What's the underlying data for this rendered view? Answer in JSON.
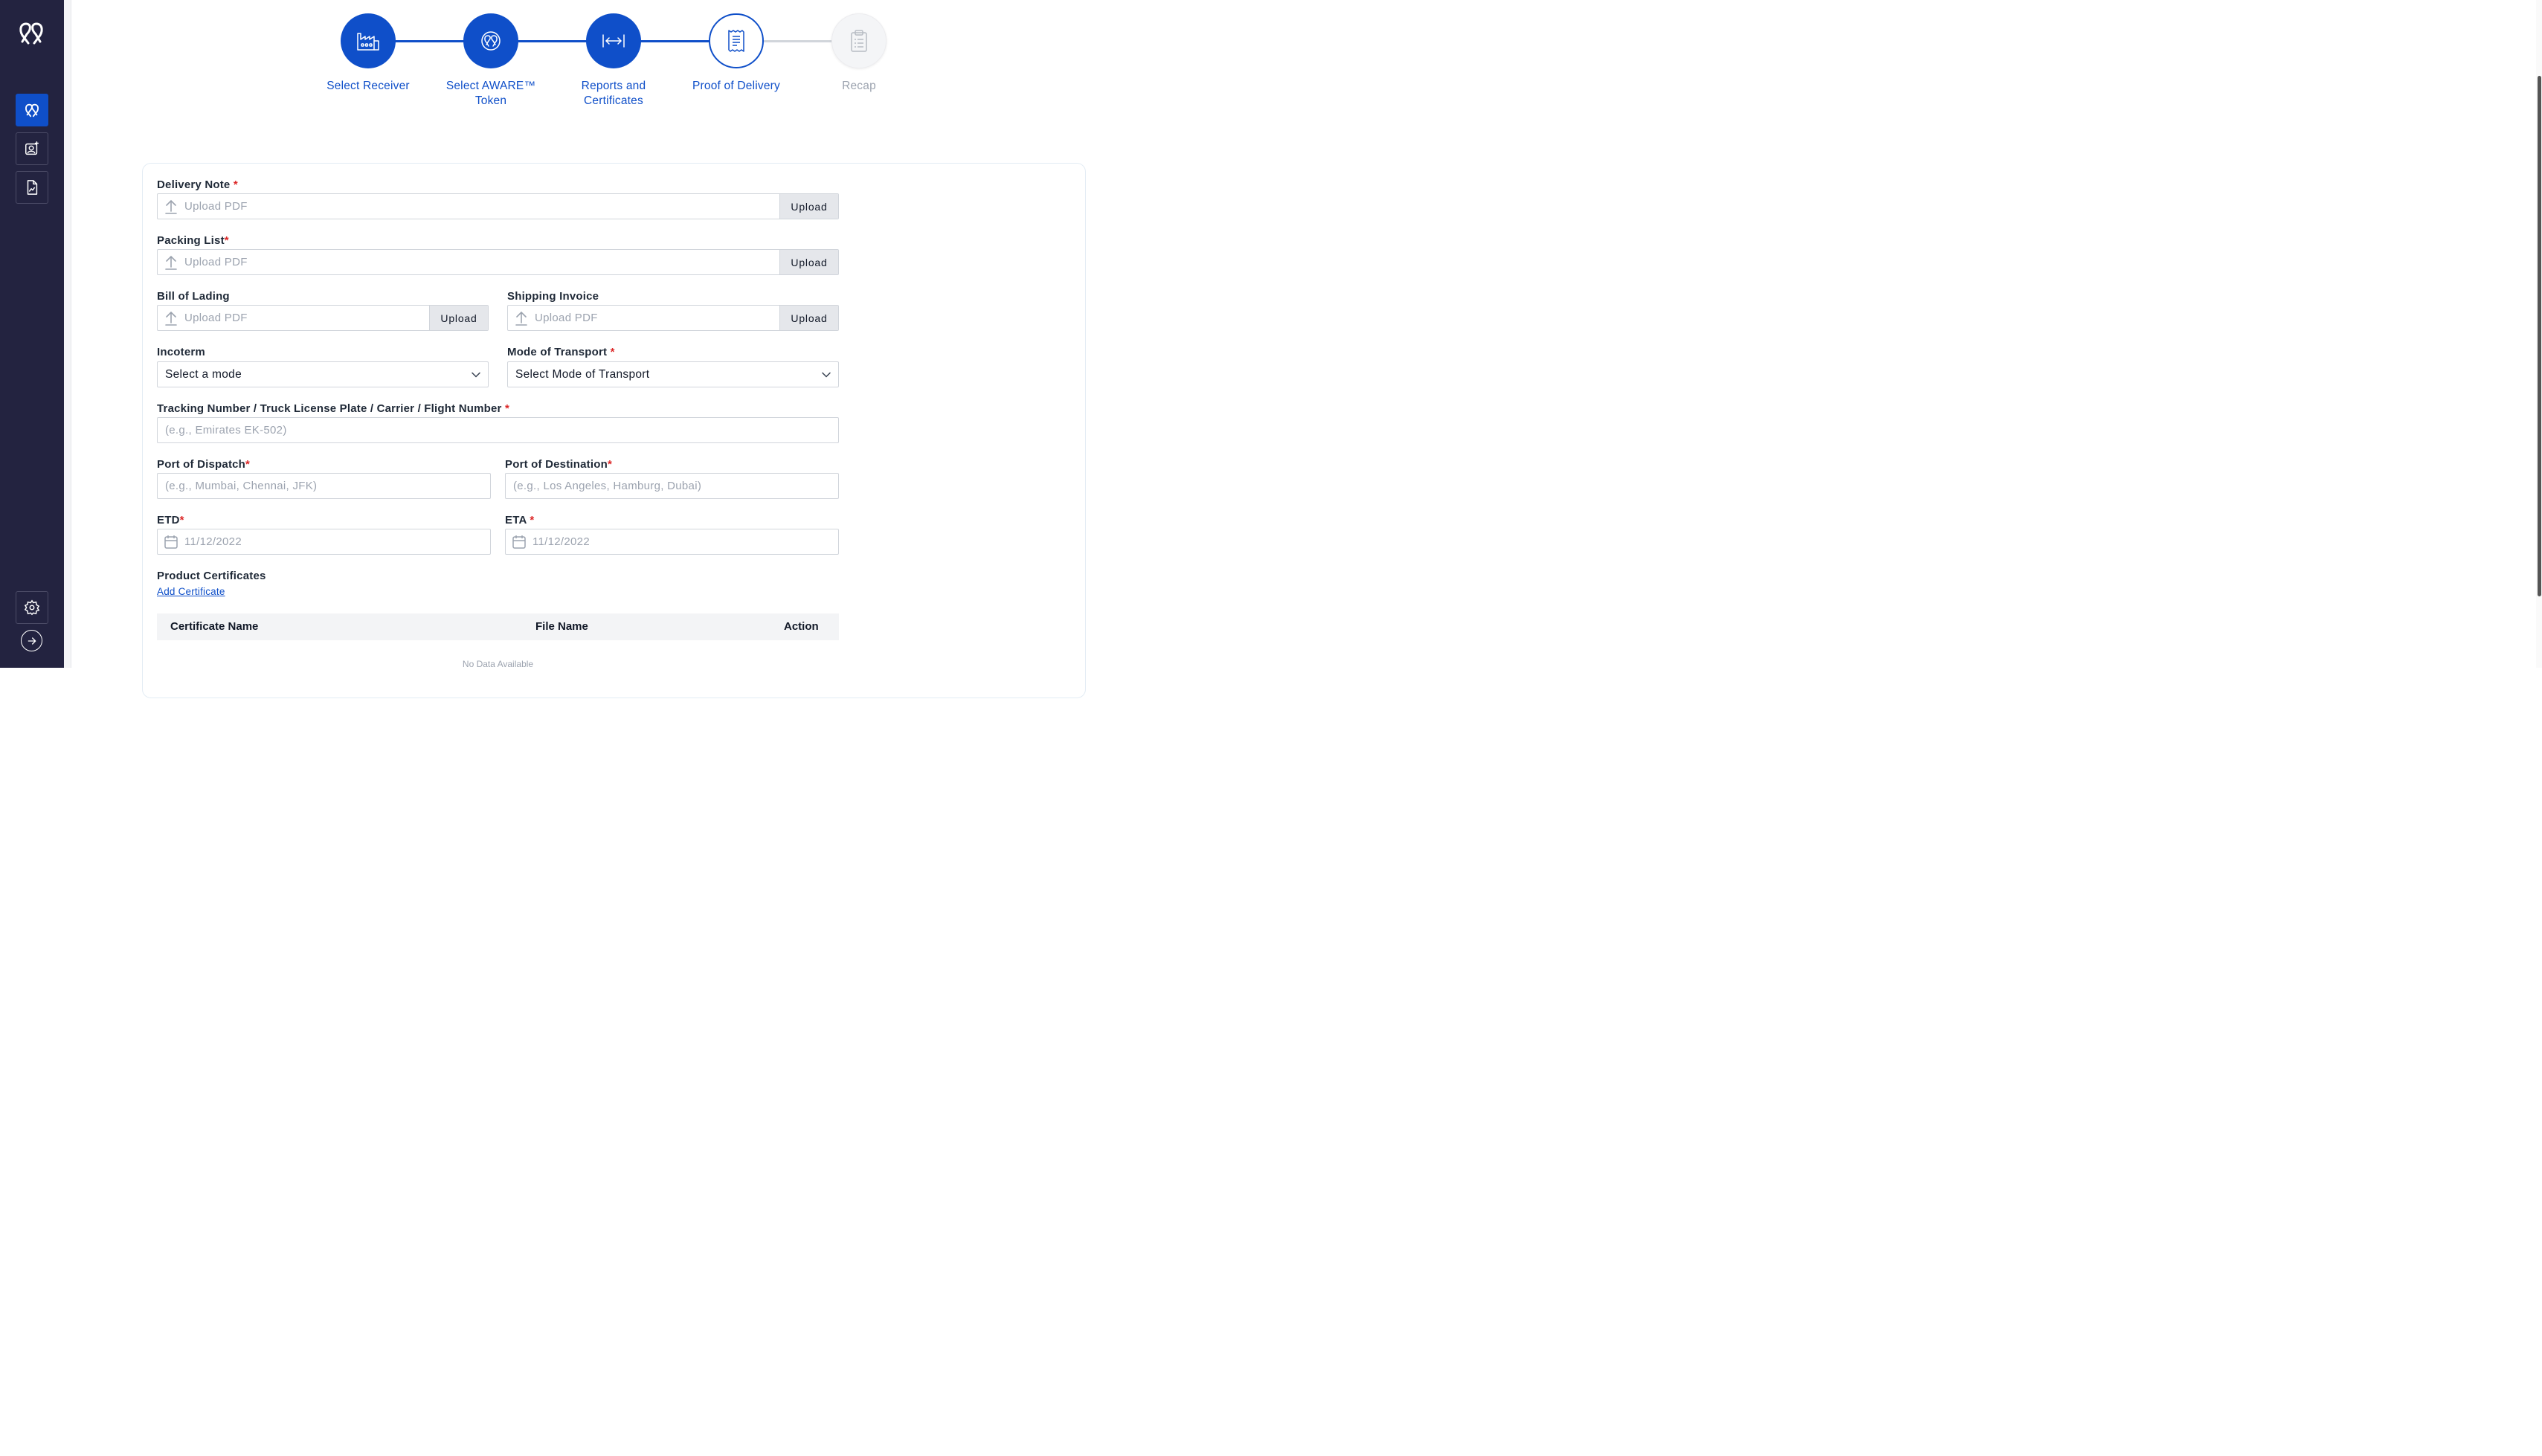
{
  "stepper": {
    "steps": [
      {
        "label": "Select Receiver",
        "state": "done",
        "icon": "factory-icon"
      },
      {
        "label": "Select AWARE™ Token",
        "state": "done",
        "icon": "aware-token-icon"
      },
      {
        "label": "Reports and Certificates",
        "state": "done",
        "icon": "arrows-horizontal-icon"
      },
      {
        "label": "Proof of Delivery",
        "state": "current",
        "icon": "receipt-icon"
      },
      {
        "label": "Recap",
        "state": "pending",
        "icon": "clipboard-icon"
      }
    ]
  },
  "form": {
    "delivery_note": {
      "label": "Delivery Note",
      "placeholder": "Upload PDF",
      "button": "Upload"
    },
    "packing_list": {
      "label": "Packing List",
      "placeholder": "Upload PDF",
      "button": "Upload"
    },
    "bill_of_lading": {
      "label": "Bill of Lading",
      "placeholder": "Upload PDF",
      "button": "Upload"
    },
    "shipping_invoice": {
      "label": "Shipping Invoice",
      "placeholder": "Upload PDF",
      "button": "Upload"
    },
    "incoterm": {
      "label": "Incoterm",
      "value": "Select a mode"
    },
    "mode_of_transport": {
      "label": "Mode of Transport",
      "value": "Select Mode of Transport"
    },
    "tracking": {
      "label": "Tracking Number / Truck License Plate / Carrier / Flight Number",
      "placeholder": "(e.g., Emirates EK-502)"
    },
    "port_dispatch": {
      "label": "Port of Dispatch",
      "placeholder": "(e.g., Mumbai, Chennai, JFK)"
    },
    "port_destination": {
      "label": "Port of Destination",
      "placeholder": "(e.g., Los Angeles, Hamburg, Dubai)"
    },
    "etd": {
      "label": "ETD",
      "placeholder": "11/12/2022"
    },
    "eta": {
      "label": "ETA",
      "placeholder": "11/12/2022"
    },
    "product_certificates": {
      "label": "Product Certificates",
      "add_link": "Add Certificate"
    },
    "required_mark": "*"
  },
  "table": {
    "columns": [
      "Certificate Name",
      "File Name",
      "Action"
    ],
    "empty_text": "No Data Available"
  },
  "colors": {
    "primary": "#0f4fc9",
    "sidebar": "#232340",
    "required": "#dc2626"
  }
}
